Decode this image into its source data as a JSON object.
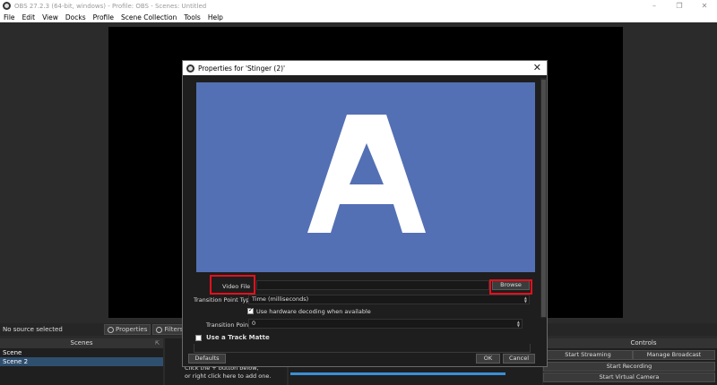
{
  "window": {
    "title": "OBS 27.2.3 (64-bit, windows) - Profile: OBS - Scenes: Untitled",
    "controls": [
      "–",
      "❐",
      "✕"
    ]
  },
  "menubar": [
    "File",
    "Edit",
    "View",
    "Docks",
    "Profile",
    "Scene Collection",
    "Tools",
    "Help"
  ],
  "source_toolbar": {
    "status": "No source selected",
    "properties_label": "Properties",
    "filters_label": "Filters"
  },
  "scenes_dock": {
    "header": "Scenes",
    "items": [
      "Scene",
      "Scene 2"
    ]
  },
  "sources_dock": {
    "hint_line1": "Click the + button below,",
    "hint_line2": "or right click here to add one."
  },
  "controls_dock": {
    "header": "Controls",
    "start_streaming": "Start Streaming",
    "manage_broadcast": "Manage Broadcast",
    "start_recording": "Start Recording",
    "start_virtual_camera": "Start Virtual Camera"
  },
  "dialog": {
    "title": "Properties for 'Stinger (2)'",
    "preview_letter": "A",
    "video_file_label": "Video File",
    "video_file_value": "",
    "browse_label": "Browse",
    "transition_point_type_label": "Transition Point Type",
    "transition_point_type_value": "Time (milliseconds)",
    "hw_decoding_label": "Use hardware decoding when available",
    "hw_decoding_checked": true,
    "transition_point_label": "Transition Point",
    "transition_point_value": "0",
    "track_matte_label": "Use a Track Matte",
    "track_matte_checked": false,
    "defaults_label": "Defaults",
    "ok_label": "OK",
    "cancel_label": "Cancel"
  },
  "colors": {
    "preview_bg": "#5470b4",
    "highlight": "#e3101c",
    "dark_bg": "#1e1e1e"
  }
}
